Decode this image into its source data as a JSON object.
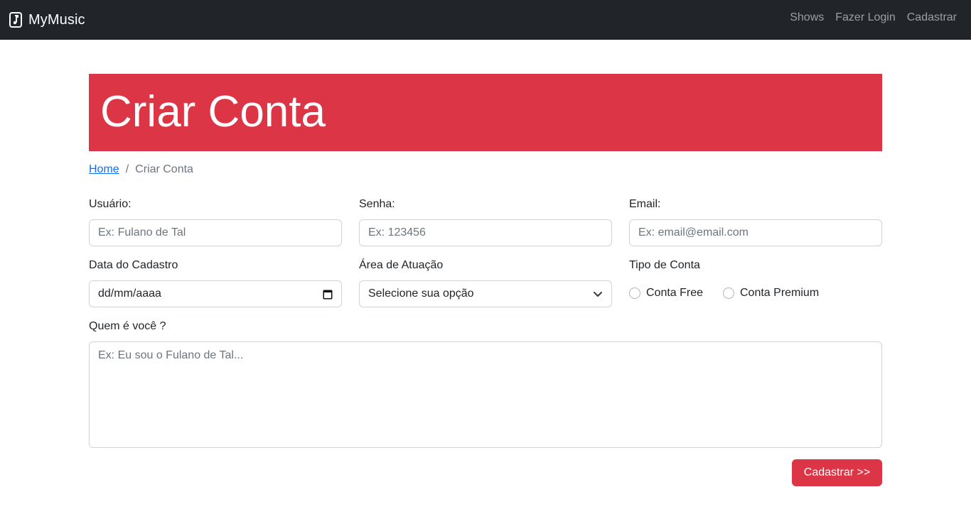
{
  "navbar": {
    "brand": "MyMusic",
    "brand_icon": "music-note-icon",
    "links": [
      "Shows",
      "Fazer Login",
      "Cadastrar"
    ]
  },
  "hero": {
    "title": "Criar Conta",
    "bg_color": "#dc3545"
  },
  "breadcrumb": {
    "home": "Home",
    "separator": "/",
    "current": "Criar Conta"
  },
  "form": {
    "usuario": {
      "label": "Usuário:",
      "placeholder": "Ex: Fulano de Tal"
    },
    "senha": {
      "label": "Senha:",
      "placeholder": "Ex: 123456"
    },
    "email": {
      "label": "Email:",
      "placeholder": "Ex: email@email.com"
    },
    "data": {
      "label": "Data do Cadastro",
      "value": "dd/mm/aaaa",
      "icon": "calendar-icon"
    },
    "area": {
      "label": "Área de Atuação",
      "selected": "Selecione sua opção"
    },
    "tipo": {
      "label": "Tipo de Conta",
      "options": [
        "Conta Free",
        "Conta Premium"
      ]
    },
    "quem": {
      "label": "Quem é você ?",
      "placeholder": "Ex: Eu sou o Fulano de Tal..."
    },
    "submit_label": "Cadastrar >>"
  },
  "colors": {
    "navbar": "#212529",
    "accent": "#dc3545",
    "link": "#0d6efd"
  }
}
